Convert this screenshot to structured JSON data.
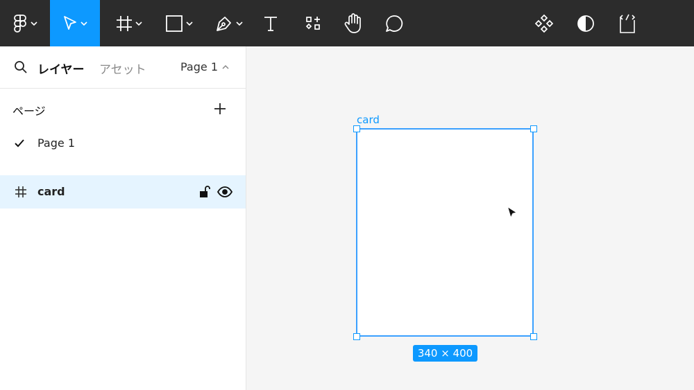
{
  "toolbar": {
    "tools": [
      {
        "name": "main-menu",
        "icon": "figma-logo-icon"
      },
      {
        "name": "move-tool",
        "icon": "cursor-arrow-icon",
        "active": true
      },
      {
        "name": "frame-tool",
        "icon": "hash-frame-icon"
      },
      {
        "name": "shape-tool",
        "icon": "rectangle-icon"
      },
      {
        "name": "pen-tool",
        "icon": "pen-icon"
      },
      {
        "name": "text-tool",
        "icon": "text-t-icon"
      },
      {
        "name": "resources-tool",
        "icon": "components-icon"
      },
      {
        "name": "hand-tool",
        "icon": "hand-icon"
      },
      {
        "name": "comment-tool",
        "icon": "comment-bubble-icon"
      },
      {
        "name": "component-button",
        "icon": "component-diamonds-icon"
      },
      {
        "name": "theme-button",
        "icon": "contrast-half-circle-icon"
      },
      {
        "name": "dev-mode-button",
        "icon": "code-brackets-icon"
      }
    ],
    "active_color": "#0d99ff",
    "background": "#2c2c2c"
  },
  "sidebar": {
    "tab_layers": "レイヤー",
    "tab_assets": "アセット",
    "page_selector": "Page 1",
    "pages_title": "ページ",
    "pages": [
      {
        "label": "Page 1",
        "selected": true
      }
    ],
    "layers": [
      {
        "label": "card",
        "type": "frame",
        "selected": true
      }
    ]
  },
  "canvas": {
    "frame_name": "card",
    "dimensions": "340 × 400",
    "selection_color": "#0d99ff"
  }
}
